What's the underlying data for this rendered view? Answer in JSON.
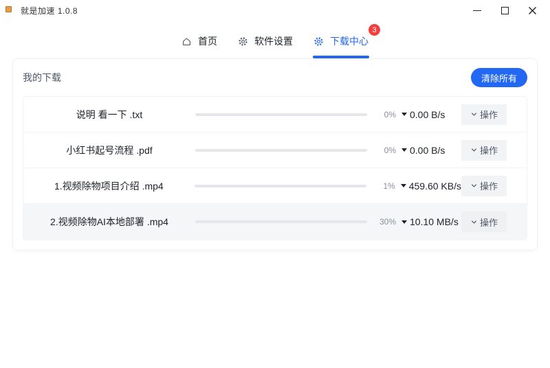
{
  "window": {
    "title": "就是加速  1.0.8",
    "controls": [
      "minimize",
      "maximize",
      "close"
    ]
  },
  "nav": {
    "tabs": [
      {
        "label": "首页",
        "icon": "home-icon",
        "active": false
      },
      {
        "label": "软件设置",
        "icon": "gear-icon",
        "active": false
      },
      {
        "label": "下载中心",
        "icon": "gear-icon",
        "active": true,
        "badge": "3"
      }
    ]
  },
  "panel": {
    "title": "我的下载",
    "clear_all_label": "清除所有",
    "action_label": "操作",
    "downloads": [
      {
        "name": "说明 看一下 .txt",
        "progress": 0,
        "percent": "0%",
        "speed": "0.00 B/s",
        "highlighted": false
      },
      {
        "name": "小红书起号流程 .pdf",
        "progress": 0.8,
        "percent": "0%",
        "speed": "0.00 B/s",
        "highlighted": false
      },
      {
        "name": "1.视频除物项目介绍 .mp4",
        "progress": 2.5,
        "percent": "1%",
        "speed": "459.60 KB/s",
        "highlighted": false
      },
      {
        "name": "2.视频除物AI本地部署 .mp4",
        "progress": 30,
        "percent": "30%",
        "speed": "10.10 MB/s",
        "highlighted": true
      }
    ]
  },
  "colors": {
    "accent": "#2268f2",
    "badge": "#f53f3f",
    "progress_track": "#e5e6eb",
    "row_highlight": "#f5f6f8"
  }
}
